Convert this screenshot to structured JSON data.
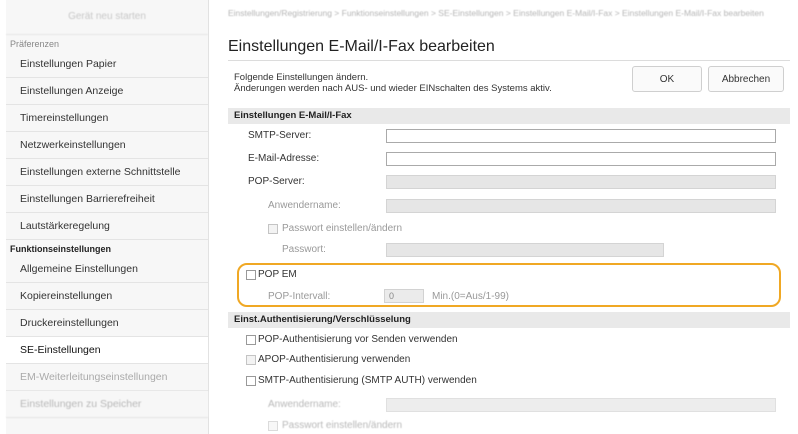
{
  "sidebar": {
    "top_label": "Gerät neu starten",
    "header_preferences": "Präferenzen",
    "items_a": [
      {
        "label": "Einstellungen Papier"
      },
      {
        "label": "Einstellungen Anzeige"
      },
      {
        "label": "Timereinstellungen"
      },
      {
        "label": "Netzwerkeinstellungen"
      },
      {
        "label": "Einstellungen externe Schnittstelle"
      },
      {
        "label": "Einstellungen Barrierefreiheit"
      },
      {
        "label": "Lautstärkeregelung"
      }
    ],
    "header_functions": "Funktionseinstellungen",
    "items_b": [
      {
        "label": "Allgemeine Einstellungen"
      },
      {
        "label": "Kopiereinstellungen"
      },
      {
        "label": "Druckereinstellungen"
      },
      {
        "label": "SE-Einstellungen"
      },
      {
        "label": "EM-Weiterleitungseinstellungen"
      },
      {
        "label": "Einstellungen zu Speicher"
      }
    ]
  },
  "main": {
    "breadcrumb": "Einstellungen/Registrierung > Funktionseinstellungen > SE-Einstellungen > Einstellungen E-Mail/I-Fax > Einstellungen E-Mail/I-Fax bearbeiten",
    "title": "Einstellungen E-Mail/I-Fax bearbeiten",
    "intro_line1": "Folgende Einstellungen ändern.",
    "intro_line2": "Änderungen werden nach AUS- und wieder EINschalten des Systems aktiv.",
    "ok_label": "OK",
    "cancel_label": "Abbrechen",
    "section1_title": "Einstellungen E-Mail/I-Fax",
    "smtp_label": "SMTP-Server:",
    "email_label": "E-Mail-Adresse:",
    "pop_label": "POP-Server:",
    "username_label": "Anwendername:",
    "pw_set_label": "Passwort einstellen/ändern",
    "password_label": "Passwort:",
    "pop_em_label": "POP EM",
    "pop_interval_label": "POP-Intervall:",
    "pop_interval_value": "0",
    "pop_interval_hint": "Min.(0=Aus/1-99)",
    "section2_title": "Einst.Authentisierung/Verschlüsselung",
    "auth_pop_label": "POP-Authentisierung vor Senden verwenden",
    "auth_apop_label": "APOP-Authentisierung verwenden",
    "auth_smtp_label": "SMTP-Authentisierung (SMTP AUTH) verwenden",
    "auth_username_label": "Anwendername:",
    "auth_pw_set_label": "Passwort einstellen/ändern"
  },
  "colors": {
    "highlight": "#f0a824",
    "section_bg": "#e9e9e9",
    "sidebar_bg": "#f7f7f7"
  }
}
